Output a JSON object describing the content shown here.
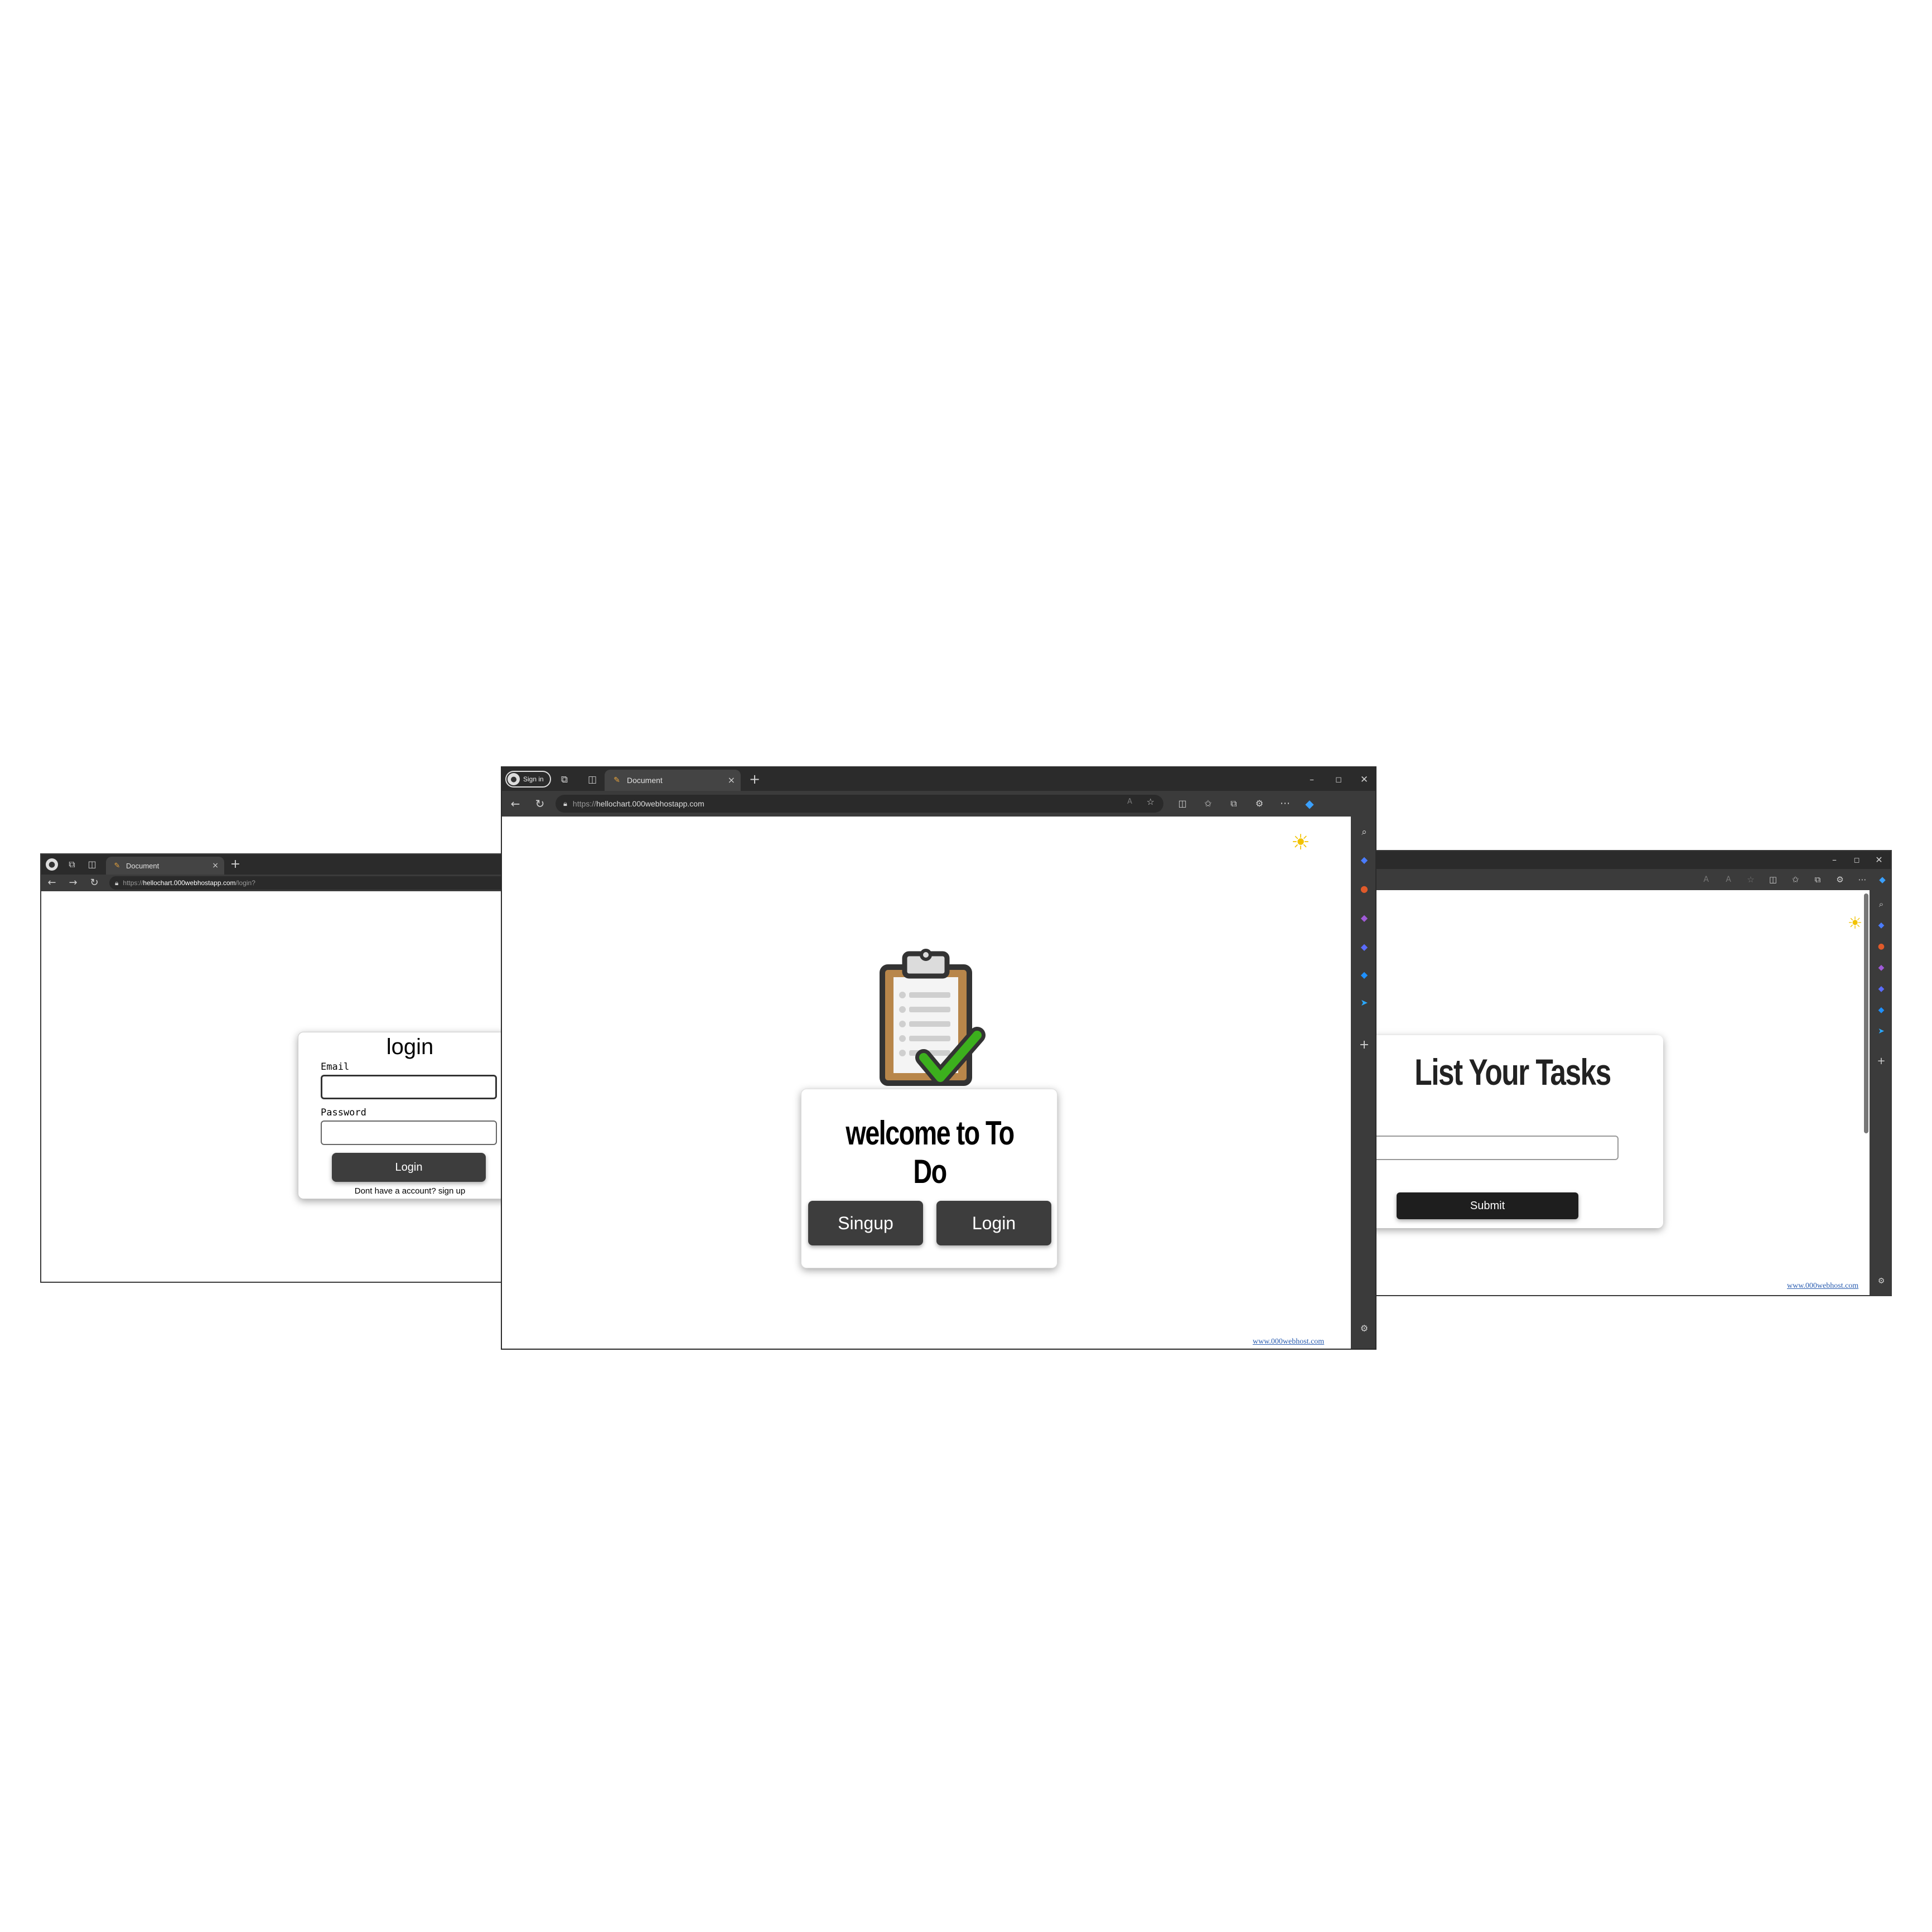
{
  "left_window": {
    "tab_label": "Document",
    "url_prefix": "https://",
    "url_host": "hellochart.000webhostapp.com",
    "url_path": "/login?",
    "login": {
      "title": "login",
      "email_label": "Email",
      "email_value": "",
      "password_label": "Password",
      "password_value": "",
      "button_label": "Login",
      "signup_prompt": "Dont have a account? sign up"
    }
  },
  "center_window": {
    "signin_label": "Sign in",
    "tab_label": "Document",
    "url_prefix": "https://",
    "url_host": "hellochart.000webhostapp.com",
    "welcome_title": "welcome to To Do",
    "signup_button": "Singup",
    "login_button": "Login",
    "footer_link": "www.000webhost.com"
  },
  "right_window": {
    "title": "List Your Tasks",
    "task_input_value": "",
    "submit_label": "Submit",
    "footer_link": "www.000webhost.com"
  },
  "icons": {
    "theme": "sun-icon",
    "hero": "clipboard-check-icon"
  },
  "colors": {
    "browser_chrome": "#2b2b2b",
    "button_dark": "#3d3d3d",
    "check_green": "#3cb01d",
    "clipboard_brown": "#b8864a"
  }
}
